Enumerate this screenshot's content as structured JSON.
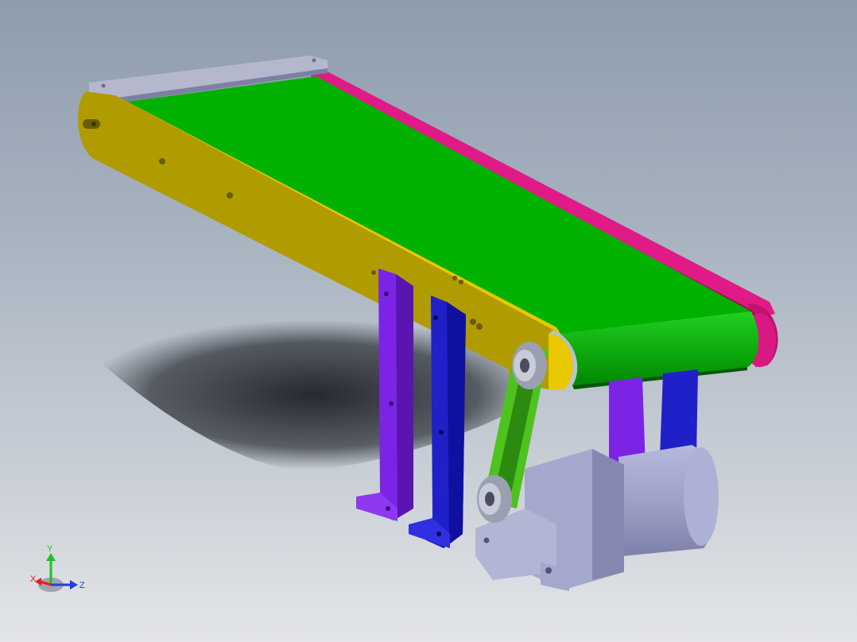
{
  "viewport": {
    "background_top": "#8e9cae",
    "background_bottom": "#e3e5e8"
  },
  "model": {
    "parts": [
      {
        "part": "belt",
        "color": "#00b100"
      },
      {
        "part": "side-frame-front",
        "color": "#b09b00"
      },
      {
        "part": "side-frame-rear",
        "color": "#c0126e"
      },
      {
        "part": "end-cap-plate",
        "color": "#a3a8c0"
      },
      {
        "part": "support-leg-front",
        "color": "#7b24e6"
      },
      {
        "part": "support-leg-rear",
        "color": "#2020c8"
      },
      {
        "part": "drive-belt",
        "color": "#4ec21e"
      },
      {
        "part": "stepper-motor",
        "color": "#9ea2c8"
      }
    ]
  },
  "triad": {
    "x_label": "X",
    "y_label": "Y",
    "z_label": "Z",
    "x_color": "#e02020",
    "y_color": "#20c020",
    "z_color": "#2040e0"
  }
}
